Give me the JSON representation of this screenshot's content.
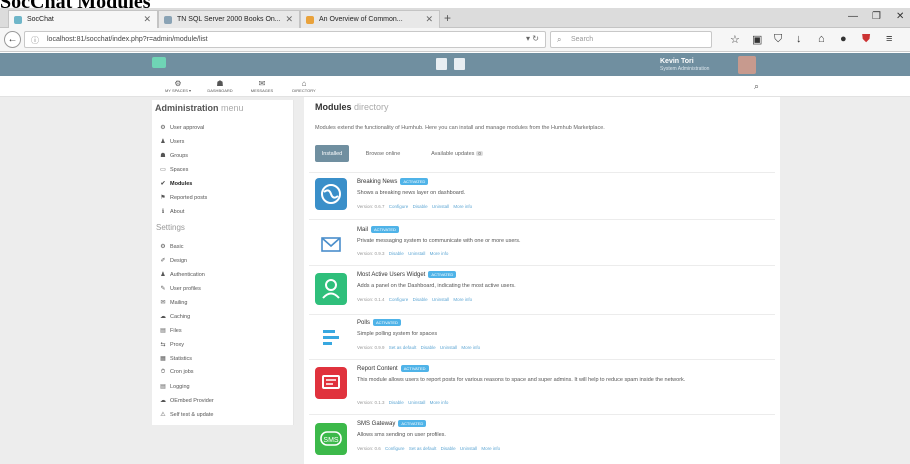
{
  "page_title": "SocChat Modules",
  "browser": {
    "tabs": [
      {
        "label": "SocChat",
        "active": true
      },
      {
        "label": "TN SQL Server 2000 Books On...",
        "active": false
      },
      {
        "label": "An Overview of Common...",
        "active": false
      }
    ],
    "url": "localhost:81/socchat/index.php?r=admin/module/list",
    "search_placeholder": "Search"
  },
  "user": {
    "name": "Kevin Tori",
    "role": "System Administration"
  },
  "top_menu": [
    {
      "label": "MY SPACES ▾",
      "glyph": "⚙"
    },
    {
      "label": "DASHBOARD",
      "glyph": "☗"
    },
    {
      "label": "MESSAGES",
      "glyph": "✉"
    },
    {
      "label": "DIRECTORY",
      "glyph": "⌂"
    }
  ],
  "sidebar": {
    "title_bold": "Administration",
    "title_light": "menu",
    "items": [
      {
        "label": "User approval",
        "glyph": "⚙"
      },
      {
        "label": "Users",
        "glyph": "♟"
      },
      {
        "label": "Groups",
        "glyph": "☗"
      },
      {
        "label": "Spaces",
        "glyph": "▭"
      },
      {
        "label": "Modules",
        "glyph": "✔",
        "active": true
      },
      {
        "label": "Reported posts",
        "glyph": "⚑"
      },
      {
        "label": "About",
        "glyph": "ℹ"
      }
    ],
    "settings_label": "Settings",
    "settings": [
      {
        "label": "Basic",
        "glyph": "⚙"
      },
      {
        "label": "Design",
        "glyph": "✐"
      },
      {
        "label": "Authentication",
        "glyph": "♟"
      },
      {
        "label": "User profiles",
        "glyph": "✎"
      },
      {
        "label": "Mailing",
        "glyph": "✉"
      },
      {
        "label": "Caching",
        "glyph": "☁"
      },
      {
        "label": "Files",
        "glyph": "▤"
      },
      {
        "label": "Proxy",
        "glyph": "⇆"
      },
      {
        "label": "Statistics",
        "glyph": "▦"
      },
      {
        "label": "Cron jobs",
        "glyph": "⏱"
      },
      {
        "label": "Logging",
        "glyph": "▤"
      },
      {
        "label": "OEmbed Provider",
        "glyph": "☁"
      },
      {
        "label": "Self test & update",
        "glyph": "⚠"
      }
    ]
  },
  "content": {
    "title_bold": "Modules",
    "title_light": "directory",
    "description": "Modules extend the functionality of Humhub. Here you can install and manage modules from the Humhub Marketplace.",
    "tabs": [
      {
        "label": "Installed",
        "active": true
      },
      {
        "label": "Browse online",
        "active": false
      },
      {
        "label": "Available updates",
        "badge": "0",
        "active": false
      }
    ],
    "modules": [
      {
        "name": "Breaking News",
        "badge": "Activated",
        "description": "Shows a breaking news layer on dashboard.",
        "version": "Version: 0.6.7",
        "links": [
          "Configure",
          "Disable",
          "Uninstall",
          "More info"
        ],
        "icon": "globe-icon",
        "color": "#3a8fc9"
      },
      {
        "name": "Mail",
        "badge": "Activated",
        "description": "Private messaging system to communicate with one or more users.",
        "version": "Version: 0.9.3",
        "links": [
          "Disable",
          "Uninstall",
          "More info"
        ],
        "icon": "envelope-icon",
        "color": "#4a8ecb"
      },
      {
        "name": "Most Active Users Widget",
        "badge": "Activated",
        "description": "Adds a panel on the Dashboard, indicating the most active users.",
        "version": "Version: 0.1.4",
        "links": [
          "Configure",
          "Disable",
          "Uninstall",
          "More info"
        ],
        "icon": "user-icon",
        "color": "#2fbf7b"
      },
      {
        "name": "Polls",
        "badge": "Activated",
        "description": "Simple polling system for spaces",
        "version": "Version: 0.9.9",
        "links": [
          "Set as default",
          "Disable",
          "Uninstall",
          "More info"
        ],
        "icon": "poll-icon",
        "color": "#38a8e0"
      },
      {
        "name": "Report Content",
        "badge": "Activated",
        "description": "This module allows users to report posts for various reasons to space and super admins. It will help to reduce spam inside the network.",
        "version": "Version: 0.1.3",
        "links": [
          "Disable",
          "Uninstall",
          "More info"
        ],
        "icon": "report-icon",
        "color": "#e0323d"
      },
      {
        "name": "SMS Gateway",
        "badge": "Activated",
        "description": "Allows sms sending on user profiles.",
        "version": "Version: 0.6",
        "links": [
          "Configure",
          "Set as default",
          "Disable",
          "Uninstall",
          "More info"
        ],
        "icon": "sms-icon",
        "color": "#3cb94a"
      }
    ]
  }
}
